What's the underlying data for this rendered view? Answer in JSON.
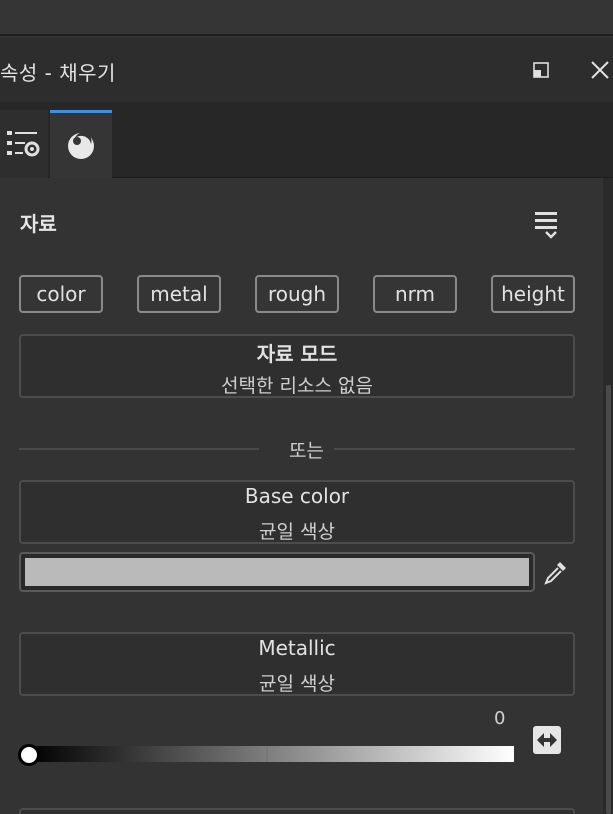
{
  "panel": {
    "title": "속성 - 채우기"
  },
  "icons": {
    "float": "float-window-icon",
    "close": "close-icon",
    "properties_tab": "properties-settings-icon",
    "material_tab": "material-sphere-icon",
    "menu": "list-menu-icon",
    "eyedropper": "eyedropper-icon",
    "swap": "swap-arrows-icon"
  },
  "material": {
    "section_label": "자료",
    "channels": [
      "color",
      "metal",
      "rough",
      "nrm",
      "height"
    ],
    "mode": {
      "title": "자료 모드",
      "subtitle": "선택한 리소스 없음"
    },
    "divider_text": "또는",
    "base_color": {
      "title": "Base color",
      "subtitle": "균일 색상",
      "swatch_color": "#bababa"
    },
    "metallic": {
      "title": "Metallic",
      "subtitle": "균일 색상",
      "value": "0",
      "slider_value": 0
    }
  },
  "colors": {
    "accent": "#3f8fdc",
    "background": "#333333"
  }
}
